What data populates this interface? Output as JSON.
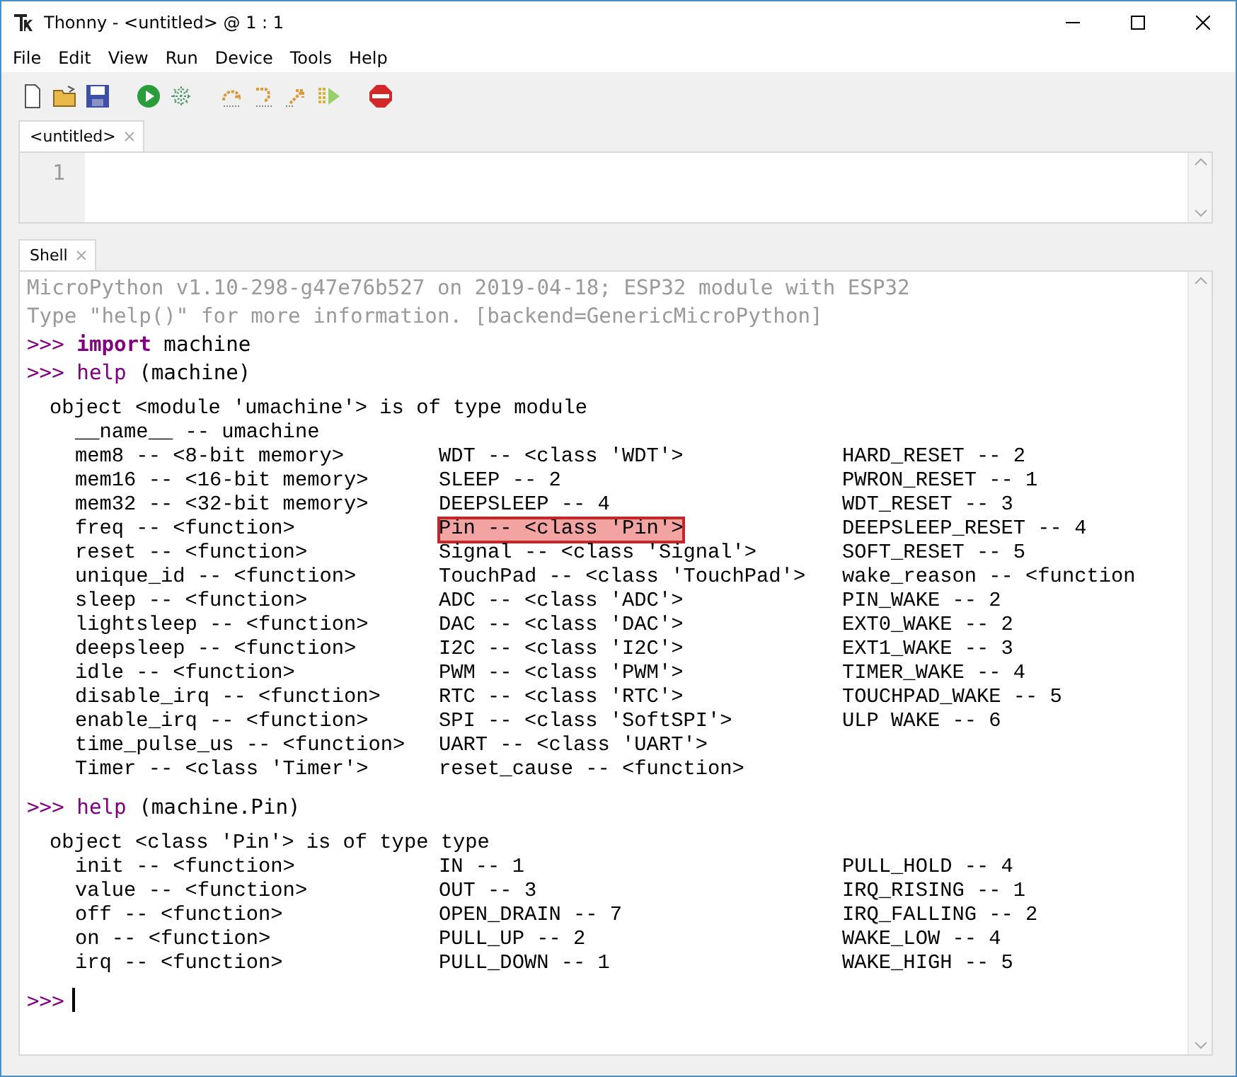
{
  "window": {
    "title": "Thonny - <untitled> @ 1 : 1"
  },
  "menu": [
    "File",
    "Edit",
    "View",
    "Run",
    "Device",
    "Tools",
    "Help"
  ],
  "editor": {
    "tabs": [
      {
        "label": "<untitled>",
        "selected": true
      }
    ],
    "line_numbers": [
      "1"
    ]
  },
  "shell": {
    "tabs": [
      {
        "label": "Shell",
        "selected": true
      }
    ],
    "banner": [
      "MicroPython v1.10-298-g47e76b527 on 2019-04-18; ESP32 module with ESP32",
      "Type \"help()\" for more information. [backend=GenericMicroPython]"
    ],
    "entries": [
      {
        "kind": "command",
        "prompt": ">>>",
        "tokens": [
          {
            "kind": "keyword",
            "text": "import"
          },
          {
            "kind": "plain",
            "text": " machine"
          }
        ]
      },
      {
        "kind": "command",
        "prompt": ">>>",
        "tokens": [
          {
            "kind": "builtin",
            "text": "help"
          },
          {
            "kind": "plain",
            "text": " (machine)"
          }
        ]
      },
      {
        "kind": "output",
        "header": "object <module 'umachine'> is of type module",
        "rows": [
          [
            "__name__ -- umachine"
          ],
          [
            "mem8 -- <8-bit memory>",
            "WDT -- <class 'WDT'>",
            "HARD_RESET -- 2"
          ],
          [
            "mem16 -- <16-bit memory>",
            "SLEEP -- 2",
            "PWRON_RESET -- 1"
          ],
          [
            "mem32 -- <32-bit memory>",
            "DEEPSLEEP -- 4",
            "WDT_RESET -- 3"
          ],
          [
            "freq -- <function>",
            {
              "text": "Pin -- <class 'Pin'>",
              "highlighted": true
            },
            "DEEPSLEEP_RESET -- 4"
          ],
          [
            "reset -- <function>",
            "Signal -- <class 'Signal'>",
            "SOFT_RESET -- 5"
          ],
          [
            "unique_id -- <function>",
            "TouchPad -- <class 'TouchPad'>",
            "wake_reason -- <function"
          ],
          [
            "sleep -- <function>",
            "ADC -- <class 'ADC'>",
            "PIN_WAKE -- 2"
          ],
          [
            "lightsleep -- <function>",
            "DAC -- <class 'DAC'>",
            "EXT0_WAKE -- 2"
          ],
          [
            "deepsleep -- <function>",
            "I2C -- <class 'I2C'>",
            "EXT1_WAKE -- 3"
          ],
          [
            "idle -- <function>",
            "PWM -- <class 'PWM'>",
            "TIMER_WAKE -- 4"
          ],
          [
            "disable_irq -- <function>",
            "RTC -- <class 'RTC'>",
            "TOUCHPAD_WAKE -- 5"
          ],
          [
            "enable_irq -- <function>",
            "SPI -- <class 'SoftSPI'>",
            "ULP WAKE -- 6"
          ],
          [
            "time_pulse_us -- <function>",
            "UART -- <class 'UART'>"
          ],
          [
            "Timer -- <class 'Timer'>",
            "reset_cause -- <function>"
          ]
        ]
      },
      {
        "kind": "command",
        "prompt": ">>>",
        "tokens": [
          {
            "kind": "builtin",
            "text": "help"
          },
          {
            "kind": "plain",
            "text": " (machine.Pin)"
          }
        ]
      },
      {
        "kind": "output",
        "header": "object <class 'Pin'> is of type type",
        "rows": [
          [
            "init -- <function>",
            "IN -- 1",
            "PULL_HOLD -- 4"
          ],
          [
            "value -- <function>",
            "OUT -- 3",
            "IRQ_RISING -- 1"
          ],
          [
            "off -- <function>",
            "OPEN_DRAIN -- 7",
            "IRQ_FALLING -- 2"
          ],
          [
            "on -- <function>",
            "PULL_UP -- 2",
            "WAKE_LOW -- 4"
          ],
          [
            "irq -- <function>",
            "PULL_DOWN -- 1",
            "WAKE_HIGH -- 5"
          ]
        ]
      },
      {
        "kind": "input",
        "prompt": ">>>"
      }
    ]
  }
}
